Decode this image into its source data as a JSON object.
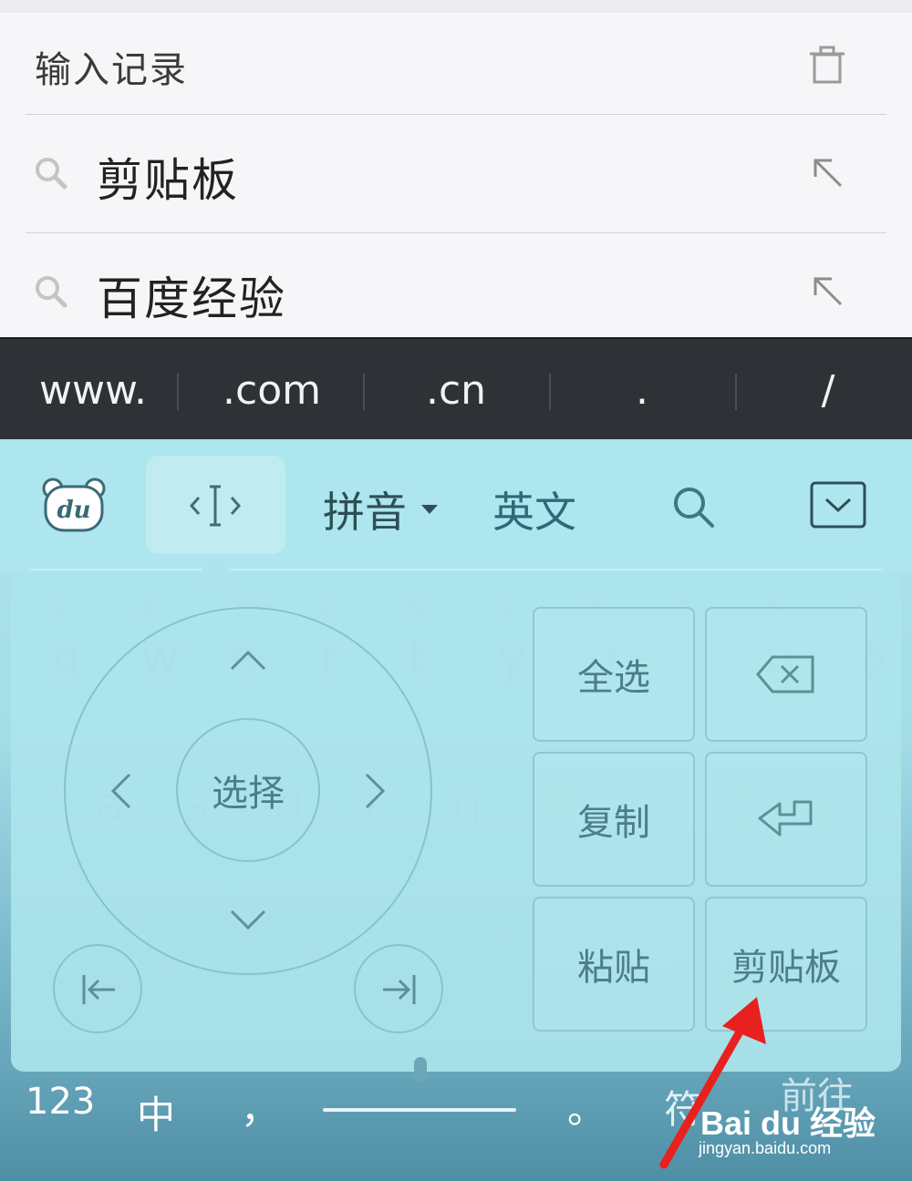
{
  "history": {
    "title": "输入记录",
    "items": [
      {
        "text": "剪贴板"
      },
      {
        "text": "百度经验"
      }
    ]
  },
  "url_bar": {
    "keys": [
      "www.",
      ".com",
      ".cn",
      ".",
      "/"
    ]
  },
  "toolbar": {
    "pinyin_label": "拼音",
    "english_label": "英文"
  },
  "background_keys": {
    "numbers": [
      "1",
      "2",
      "3",
      "4",
      "5",
      "6",
      "7",
      "8",
      "9",
      "0"
    ],
    "row1": [
      "q",
      "w",
      "e",
      "r",
      "t",
      "y",
      "u",
      "i",
      "o",
      "p"
    ],
    "row2": [
      "a",
      "s",
      "d",
      "f",
      "g",
      "h",
      "j",
      "k",
      "l"
    ],
    "row3": [
      "z",
      "x",
      "c",
      "v",
      "b",
      "n",
      "m"
    ]
  },
  "edit_panel": {
    "select_label": "选择",
    "select_all_label": "全选",
    "copy_label": "复制",
    "paste_label": "粘贴",
    "clipboard_label": "剪贴板"
  },
  "bottom_row": {
    "num_label": "123",
    "lang_label": "中",
    "comma_label": "，",
    "period_label": "。",
    "symbol_label": "符",
    "go_label": "前往"
  },
  "watermark": {
    "logo": "Bai du 经验",
    "url": "jingyan.baidu.com"
  },
  "colors": {
    "keyboard_bg": "#aee4ec",
    "url_bar_bg": "#2e3135",
    "annotation_arrow": "#e8201e"
  }
}
